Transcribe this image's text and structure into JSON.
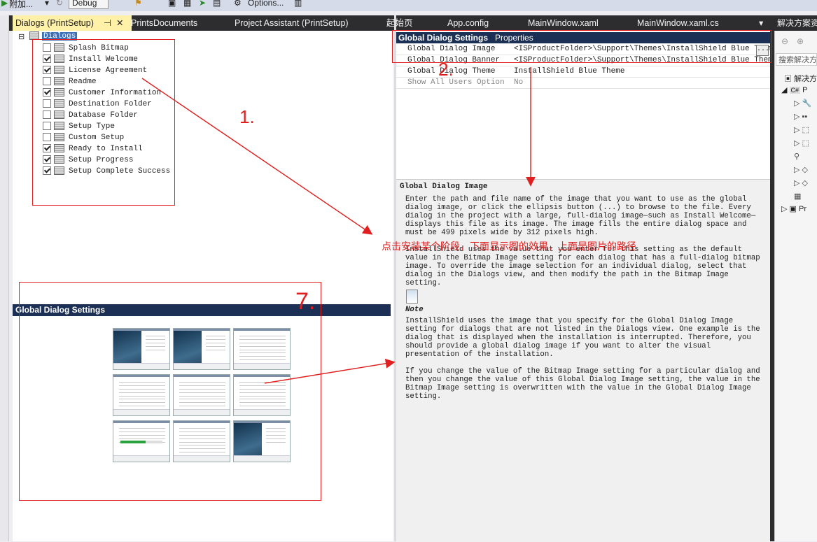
{
  "toolbar": {
    "attach_label": "附加...",
    "config_value": "Debug",
    "options_label": "Options..."
  },
  "tabs": [
    {
      "label": "Dialogs (PrintSetup)",
      "active": true
    },
    {
      "label": "PrintsDocuments"
    },
    {
      "label": "Project Assistant (PrintSetup)"
    },
    {
      "label": "起始页"
    },
    {
      "label": "App.config"
    },
    {
      "label": "MainWindow.xaml"
    },
    {
      "label": "MainWindow.xaml.cs"
    }
  ],
  "tab_pin": "⊣",
  "tab_close": "✕",
  "tab_overflow": "▾",
  "dialogs_tree": {
    "root_label": "Dialogs",
    "items": [
      {
        "label": "Splash Bitmap",
        "checked": false
      },
      {
        "label": "Install Welcome",
        "checked": true
      },
      {
        "label": "License Agreement",
        "checked": true
      },
      {
        "label": "Readme",
        "checked": false
      },
      {
        "label": "Customer Information",
        "checked": true
      },
      {
        "label": "Destination Folder",
        "checked": false
      },
      {
        "label": "Database Folder",
        "checked": false
      },
      {
        "label": "Setup Type",
        "checked": false
      },
      {
        "label": "Custom Setup",
        "checked": false
      },
      {
        "label": "Ready to Install",
        "checked": true
      },
      {
        "label": "Setup Progress",
        "checked": true
      },
      {
        "label": "Setup Complete Success",
        "checked": true
      }
    ]
  },
  "preview": {
    "header": "Global Dialog Settings"
  },
  "properties": {
    "header_title": "Global Dialog Settings",
    "header_sub": "Properties",
    "rows": [
      {
        "name": "Global Dialog Image",
        "value": "<ISProductFolder>\\Support\\Themes\\InstallShield Blue Theme\\"
      },
      {
        "name": "Global Dialog Banner",
        "value": "<ISProductFolder>\\Support\\Themes\\InstallShield Blue Theme\\ban"
      },
      {
        "name": "Global Dialog Theme",
        "value": "InstallShield Blue Theme"
      },
      {
        "name": "Show All Users Option",
        "value": "No"
      }
    ],
    "ellipsis": "..."
  },
  "description": {
    "title": "Global Dialog Image",
    "para1": "Enter the path and file name of the image that you want to use as the global dialog image, or click the ellipsis button (...) to browse to the file. Every dialog in the project with a large, full-dialog image—such as Install Welcome—displays this file as its image. The image fills the entire dialog space and must be 499 pixels wide by 312 pixels high.",
    "para2": "InstallShield uses the value that you enter for this setting as the default value in the Bitmap Image setting for each dialog that has a full-dialog bitmap image. To override the image selection for an individual dialog, select that dialog in the Dialogs view, and then modify the path in the Bitmap Image setting.",
    "note_label": "Note",
    "note_text": "InstallShield uses the image that you specify for the Global Dialog Image setting for dialogs that are not listed in the Dialogs view. One example is the dialog that is displayed when the installation is interrupted. Therefore, you should provide a global dialog image if you want to alter the visual presentation of the installation.",
    "para3": "If you change the value of the Bitmap Image setting for a particular dialog and then you change the value of this Global Dialog Image setting, the value in the Bitmap Image setting is overwritten with the value in the Global Dialog Image setting."
  },
  "solution": {
    "title": "解决方案资",
    "search_placeholder": "搜索解决方",
    "item_label": "解决方",
    "project_label": "P",
    "project2_label": "Pr"
  },
  "annotations": {
    "mark1": "1.",
    "mark2": "2.",
    "mark7": "7.",
    "note_cn": "点击安装某个阶段，下面显示图的效果，上面是图片的路径"
  },
  "colors": {
    "accent_annotation": "#e02020",
    "header_navy": "#1c2f54",
    "tab_bar": "#2d2d30",
    "active_tab": "#fff1a8"
  }
}
